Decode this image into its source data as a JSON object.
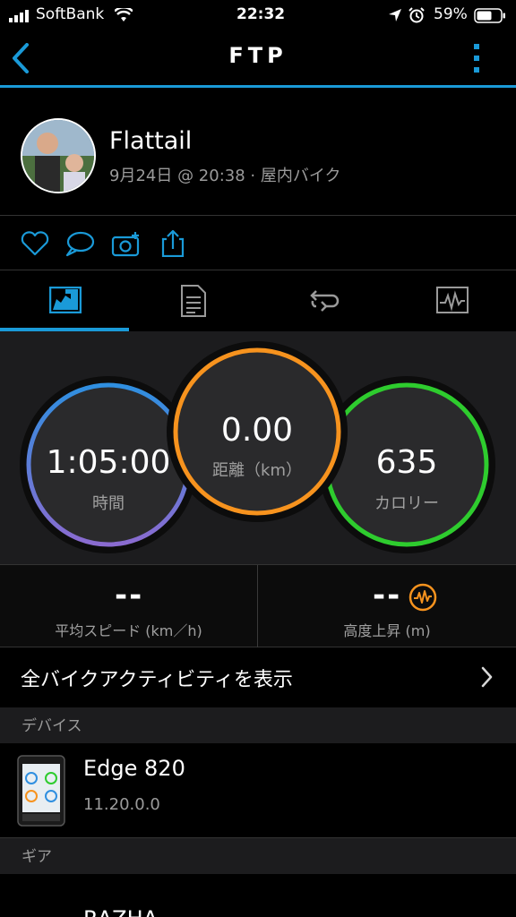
{
  "status_bar": {
    "carrier": "SoftBank",
    "time": "22:32",
    "battery": "59%"
  },
  "nav": {
    "title": "FTP"
  },
  "profile": {
    "name": "Flattail",
    "meta": "9月24日 @ 20:38 · 屋内バイク"
  },
  "metrics": {
    "time": {
      "value": "1:05:00",
      "label": "時間"
    },
    "distance": {
      "value": "0.00",
      "label": "距離（km）"
    },
    "calories": {
      "value": "635",
      "label": "カロリー"
    }
  },
  "stats": {
    "avg_speed": {
      "value": "--",
      "label": "平均スピード (km／h)"
    },
    "elevation": {
      "value": "--",
      "label": "高度上昇 (m)"
    }
  },
  "all_bike_activities": "全バイクアクティビティを表示",
  "sections": {
    "device": "デバイス",
    "gear": "ギア"
  },
  "device": {
    "name": "Edge 820",
    "version": "11.20.0.0"
  },
  "gear": {
    "name": "RAZHA"
  },
  "colors": {
    "accent": "#1a9ad8",
    "time_ring_top": "#2f8fe0",
    "time_ring_bottom": "#8a6bd0",
    "distance_ring": "#f7931e",
    "calories_ring": "#2ecc2e"
  }
}
